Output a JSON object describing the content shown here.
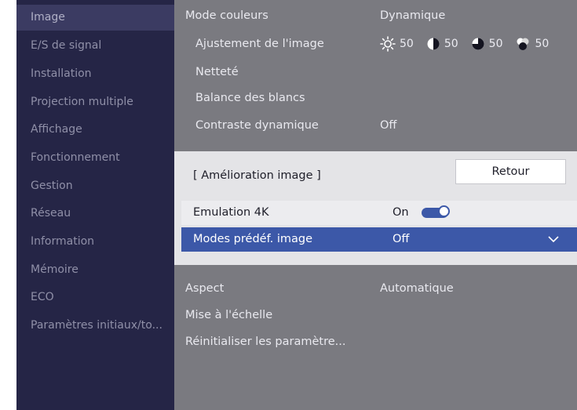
{
  "sidebar": {
    "items": [
      {
        "label": "Image",
        "active": true
      },
      {
        "label": "E/S de signal"
      },
      {
        "label": "Installation"
      },
      {
        "label": "Projection multiple"
      },
      {
        "label": "Affichage"
      },
      {
        "label": "Fonctionnement"
      },
      {
        "label": "Gestion"
      },
      {
        "label": "Réseau"
      },
      {
        "label": "Information"
      },
      {
        "label": "Mémoire"
      },
      {
        "label": "ECO"
      },
      {
        "label": "Paramètres initiaux/to..."
      }
    ]
  },
  "main": {
    "color_mode": {
      "label": "Mode couleurs",
      "value": "Dynamique"
    },
    "image_adjust": {
      "label": "Ajustement de l'image",
      "values": [
        {
          "icon": "brightness-icon",
          "value": "50"
        },
        {
          "icon": "contrast-icon",
          "value": "50"
        },
        {
          "icon": "saturation-icon",
          "value": "50"
        },
        {
          "icon": "tint-icon",
          "value": "50"
        }
      ]
    },
    "sharpness": {
      "label": "Netteté"
    },
    "white_balance": {
      "label": "Balance des blancs"
    },
    "dynamic_contrast": {
      "label": "Contraste dynamique",
      "value": "Off"
    },
    "aspect": {
      "label": "Aspect",
      "value": "Automatique"
    },
    "scaling": {
      "label": "Mise à l'échelle"
    },
    "reset": {
      "label": "Réinitialiser les paramètre..."
    }
  },
  "dialog": {
    "title": "[ Amélioration image ]",
    "back_label": "Retour",
    "emulation": {
      "label": "Emulation 4K",
      "value": "On",
      "toggle_on": true
    },
    "preset": {
      "label": "Modes prédéf. image",
      "value": "Off"
    }
  },
  "colors": {
    "accent": "#3c58a8",
    "sidebar_bg": "#252546",
    "panel_bg": "#7a7a80",
    "dialog_bg": "#e4e4e7"
  }
}
